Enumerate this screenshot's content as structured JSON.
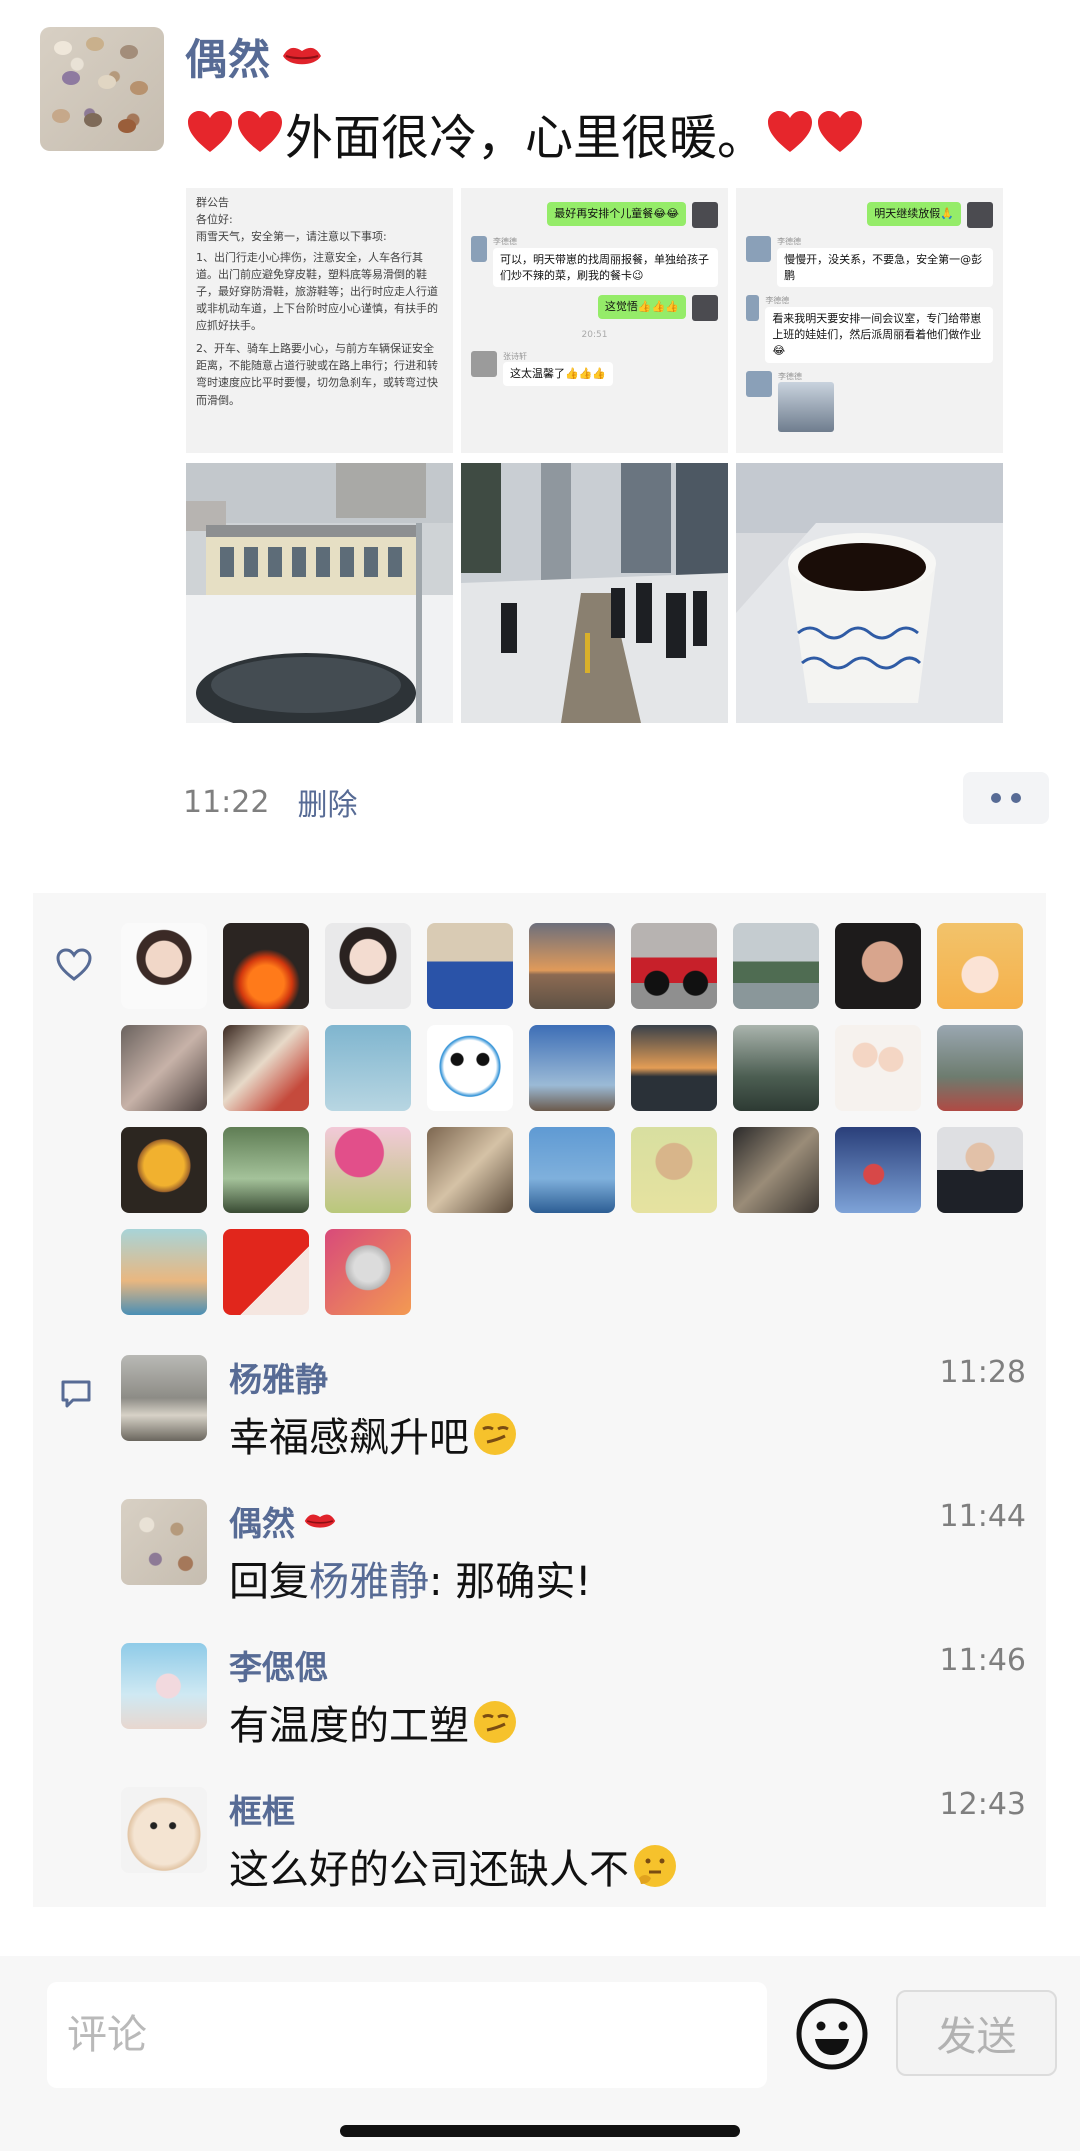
{
  "post": {
    "author": "偶然",
    "text": "外面很冷，心里很暖。",
    "time": "11:22",
    "delete_label": "删除",
    "photos": [
      {
        "kind": "screenshot-notice",
        "lines": [
          "群公告",
          "各位好:",
          "雨雪天气，安全第一，请注意以下事项:",
          "1、出门行走小心摔伤，注意安全，人车各行其道。出门前应避免穿皮鞋，塑料底等易滑倒的鞋子，最好穿防滑鞋，旅游鞋等；出行时应走人行道或非机动车道，上下台阶时应小心谨慎，有扶手的应抓好扶手。",
          "2、开车、骑车上路要小心，与前方车辆保证安全距离，不能随意占道行驶或在路上串行；行进和转弯时速度应比平时要慢，切勿急刹车，或转弯过快而滑倒。"
        ]
      },
      {
        "kind": "screenshot-chat",
        "messages": [
          {
            "side": "right",
            "text": "最好再安排个儿童餐😂😂"
          },
          {
            "side": "left",
            "name": "李德德",
            "text": "可以，明天带崽的找周丽报餐，单独给孩子们炒不辣的菜，刷我的餐卡😉"
          },
          {
            "side": "right",
            "text": "这觉悟👍👍👍"
          },
          {
            "side": "center",
            "text": "20:51"
          },
          {
            "side": "left",
            "name": "张诗轩",
            "text": "这太温馨了👍👍👍"
          }
        ]
      },
      {
        "kind": "screenshot-chat",
        "messages": [
          {
            "side": "right",
            "text": "明天继续放假🙏"
          },
          {
            "side": "left",
            "name": "李德德",
            "text": "慢慢开，没关系，不要急，安全第一@彭鹏"
          },
          {
            "side": "left",
            "name": "李德德",
            "text": "看来我明天要安排一间会议室，专门给带崽上班的娃娃们，然后派周丽看着他们做作业😂"
          },
          {
            "side": "left",
            "name": "李德德",
            "text": ""
          }
        ]
      },
      {
        "kind": "photo",
        "subject": "snowy-courtyard"
      },
      {
        "kind": "photo",
        "subject": "people-shoveling-snow"
      },
      {
        "kind": "photo",
        "subject": "cup-of-coffee"
      }
    ]
  },
  "likes": {
    "count": 30
  },
  "comments": [
    {
      "name": "杨雅静",
      "time": "11:28",
      "text": "幸福感飙升吧",
      "emoji": "smirk",
      "has_lips": false
    },
    {
      "name": "偶然",
      "time": "11:44",
      "reply_prefix": "回复",
      "reply_to": "杨雅静",
      "text": ": 那确实!",
      "has_lips": true
    },
    {
      "name": "李偲偲",
      "time": "11:46",
      "text": "有温度的工塑",
      "emoji": "smirk",
      "has_lips": false
    },
    {
      "name": "框框",
      "time": "12:43",
      "text": "这么好的公司还缺人不",
      "emoji": "thinking",
      "has_lips": false
    }
  ],
  "input": {
    "placeholder": "评论",
    "send_label": "发送"
  },
  "colors": {
    "link": "#576b95",
    "panel_bg": "#f7f7f7",
    "heart": "#e6262c"
  }
}
